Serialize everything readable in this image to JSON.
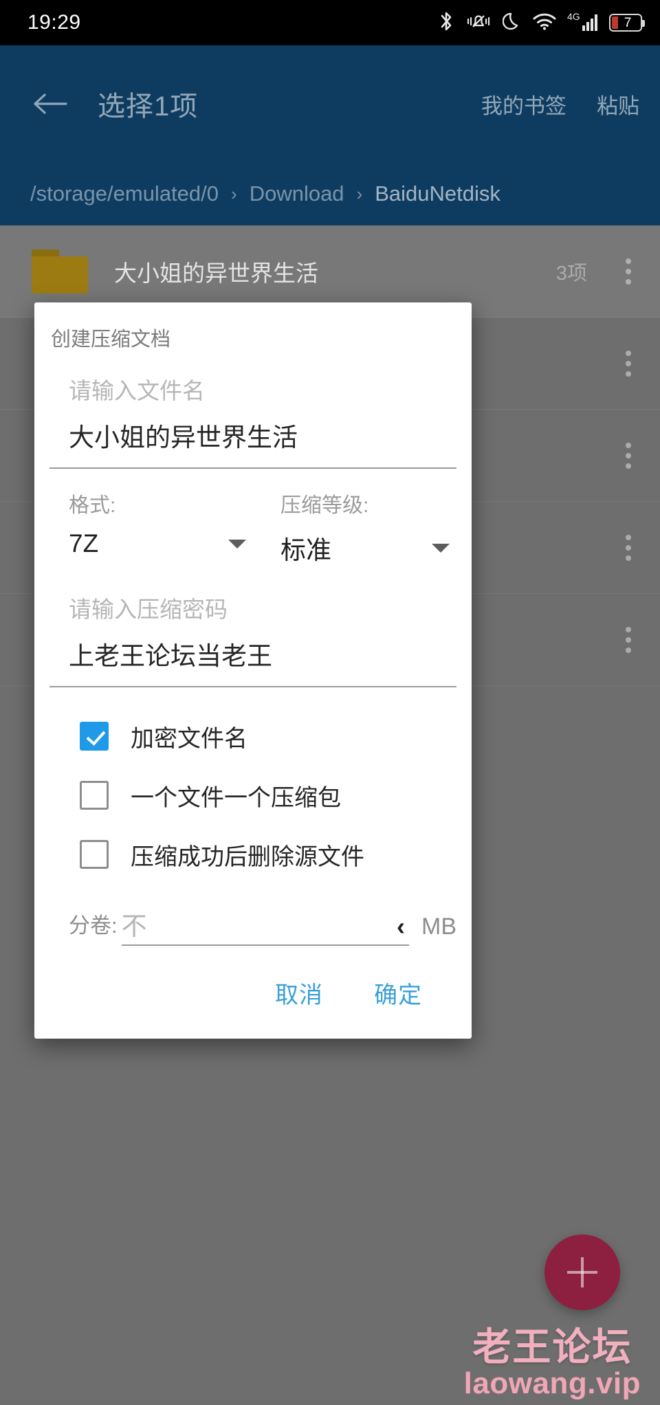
{
  "status_bar": {
    "time": "19:29",
    "icons": [
      "bluetooth-icon",
      "vibrate-mute-icon",
      "dnd-moon-icon",
      "wifi-icon",
      "signal-4g-icon",
      "battery-icon"
    ],
    "network_type": "4G",
    "battery_level": "7"
  },
  "app_bar": {
    "back_icon": "back-arrow-icon",
    "title": "选择1项",
    "actions": [
      {
        "label": "我的书签"
      },
      {
        "label": "粘贴"
      }
    ],
    "breadcrumb": {
      "separator": "›",
      "parts": [
        "/storage/emulated/0",
        "Download",
        "BaiduNetdisk"
      ]
    },
    "background_color": "#0e3c61"
  },
  "file_list": {
    "rows": [
      {
        "icon": "folder-icon",
        "name": "大小姐的异世界生活",
        "meta": "3项",
        "selected": true
      },
      {
        "icon": "file-icon",
        "name": "",
        "meta": "",
        "selected": false
      },
      {
        "icon": "file-icon",
        "name": "",
        "meta": "",
        "selected": false
      },
      {
        "icon": "file-icon",
        "name": "",
        "meta": "",
        "selected": false
      },
      {
        "icon": "file-icon",
        "name": "",
        "meta": "",
        "selected": false
      }
    ]
  },
  "fab": {
    "icon": "plus-icon"
  },
  "watermark": {
    "line1": "老王论坛",
    "line2": "laowang.vip",
    "color": "#f2b0bf"
  },
  "dialog": {
    "title": "创建压缩文档",
    "filename": {
      "placeholder": "请输入文件名",
      "value": "大小姐的异世界生活"
    },
    "format": {
      "label": "格式:",
      "value": "7Z"
    },
    "level": {
      "label": "压缩等级:",
      "value": "标准"
    },
    "password": {
      "placeholder": "请输入压缩密码",
      "value": "上老王论坛当老王"
    },
    "checkboxes": [
      {
        "label": "加密文件名",
        "checked": true
      },
      {
        "label": "一个文件一个压缩包",
        "checked": false
      },
      {
        "label": "压缩成功后删除源文件",
        "checked": false
      }
    ],
    "volume": {
      "label": "分卷:",
      "value": "不",
      "chevron": "‹",
      "unit": "MB"
    },
    "buttons": {
      "cancel": "取消",
      "confirm": "确定"
    },
    "accent_color": "#3aa0d8"
  }
}
